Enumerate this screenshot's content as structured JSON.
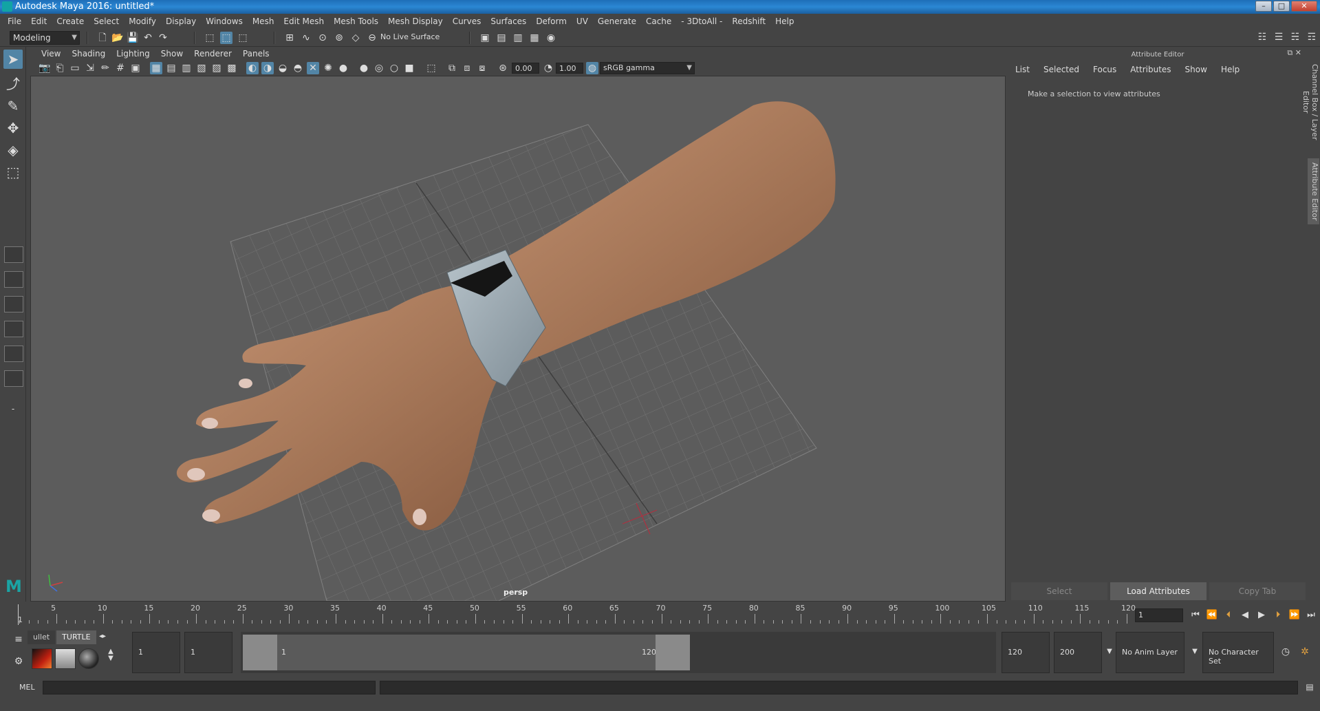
{
  "window": {
    "title": "Autodesk Maya 2016: untitled*",
    "minimize": "–",
    "maximize": "□",
    "close": "✕"
  },
  "menubar": [
    "File",
    "Edit",
    "Create",
    "Select",
    "Modify",
    "Display",
    "Windows",
    "Mesh",
    "Edit Mesh",
    "Mesh Tools",
    "Mesh Display",
    "Curves",
    "Surfaces",
    "Deform",
    "UV",
    "Generate",
    "Cache",
    "- 3DtoAll -",
    "Redshift",
    "Help"
  ],
  "statusline": {
    "menuset": "Modeling",
    "live_surface": "No Live Surface"
  },
  "panel_menu": [
    "View",
    "Shading",
    "Lighting",
    "Show",
    "Renderer",
    "Panels"
  ],
  "panel_toolbar": {
    "exposure": "0.00",
    "gamma": "1.00",
    "color_space": "sRGB gamma"
  },
  "viewport": {
    "camera": "persp",
    "skin_color": "#b07f5e",
    "grid_color": "#6e6e6e",
    "band_color": "#9aa7b0"
  },
  "attribute_editor": {
    "title": "Attribute Editor",
    "menu": [
      "List",
      "Selected",
      "Focus",
      "Attributes",
      "Show",
      "Help"
    ],
    "message": "Make a selection to view attributes",
    "buttons": {
      "select": "Select",
      "load": "Load Attributes",
      "copy": "Copy Tab"
    }
  },
  "side_tabs": {
    "channel_box": "Channel Box / Layer Editor",
    "attribute_editor": "Attribute Editor"
  },
  "timeslider": {
    "ticks": [
      5,
      10,
      15,
      20,
      25,
      30,
      35,
      40,
      45,
      50,
      55,
      60,
      65,
      70,
      75,
      80,
      85,
      90,
      95,
      100,
      105,
      110,
      115,
      120
    ],
    "start": 1,
    "end": 120,
    "current": "1",
    "start_label": "1"
  },
  "shelf": {
    "tabs": [
      "ullet",
      "TURTLE"
    ]
  },
  "range": {
    "start_time": "1",
    "playback_start": "1",
    "handle_start": "1",
    "handle_end": "120",
    "playback_end": "120",
    "end_time": "200",
    "anim_layer": "No Anim Layer",
    "character_set": "No Character Set"
  },
  "command_line": {
    "label": "MEL"
  }
}
